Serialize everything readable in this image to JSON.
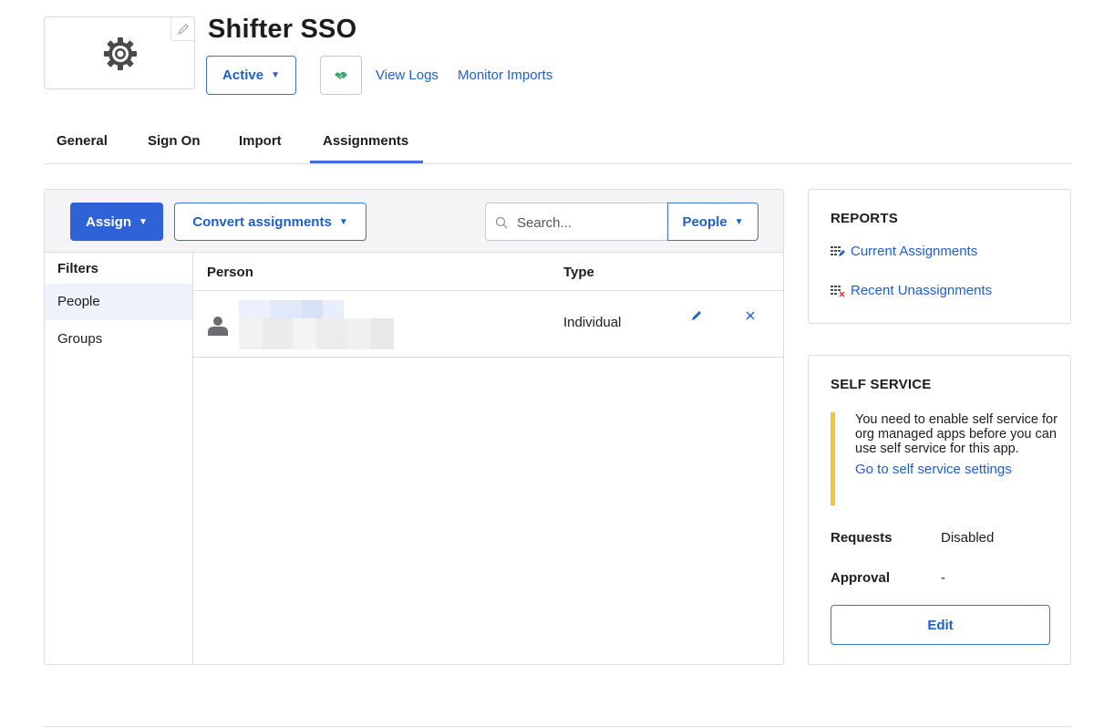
{
  "app": {
    "title": "Shifter SSO",
    "logo_icon": "gear-icon",
    "status_label": "Active",
    "links": {
      "view_logs": "View Logs",
      "monitor_imports": "Monitor Imports"
    }
  },
  "tabs": [
    {
      "label": "General"
    },
    {
      "label": "Sign On"
    },
    {
      "label": "Import"
    },
    {
      "label": "Assignments",
      "active": true
    }
  ],
  "toolbar": {
    "assign_label": "Assign",
    "convert_label": "Convert assignments",
    "search_placeholder": "Search...",
    "search_scope": "People",
    "caret": "▼"
  },
  "filters": {
    "title": "Filters",
    "items": [
      {
        "label": "People",
        "selected": true
      },
      {
        "label": "Groups"
      }
    ]
  },
  "table": {
    "headers": {
      "person": "Person",
      "type": "Type"
    },
    "rows": [
      {
        "type": "Individual"
      }
    ]
  },
  "reports": {
    "title": "REPORTS",
    "current": "Current Assignments",
    "recent": "Recent Unassignments"
  },
  "self_service": {
    "title": "SELF SERVICE",
    "notice": "You need to enable self service for org managed apps before you can use self service for this app.",
    "notice_link": "Go to self service settings",
    "requests_label": "Requests",
    "requests_value": "Disabled",
    "approval_label": "Approval",
    "approval_value": "-",
    "edit_label": "Edit"
  },
  "colors": {
    "accent": "#2f62d6",
    "link": "#1f5fc9",
    "warning_bar": "#f2c335",
    "handshake": "#3aa36b"
  }
}
